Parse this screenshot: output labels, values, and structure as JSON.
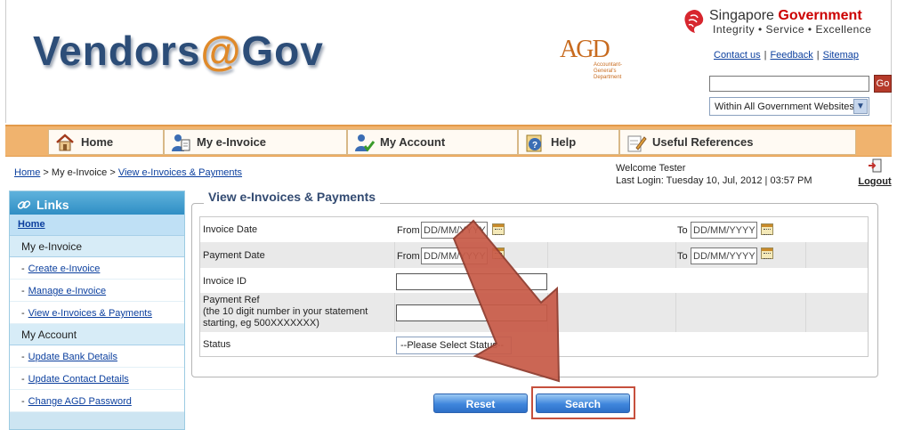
{
  "header": {
    "logo_part1": "Vendors",
    "logo_at": "@",
    "logo_part2": "Gov",
    "agd_letters": "AGD",
    "agd_sub1": "Accountant-",
    "agd_sub2": "General's",
    "agd_sub3": "Department",
    "sg_title_1": "Singapore",
    "sg_title_2": "Government",
    "sg_motto": "Integrity • Service • Excellence",
    "links": {
      "contact": "Contact us",
      "feedback": "Feedback",
      "sitemap": "Sitemap",
      "sep": "|"
    },
    "search_value": "",
    "go_label": "Go",
    "scope_selected": "Within All Government Websites"
  },
  "nav": {
    "home": "Home",
    "einvoice": "My e-Invoice",
    "account": "My Account",
    "help": "Help",
    "references": "Useful References"
  },
  "breadcrumb": {
    "home": "Home",
    "sep": ">",
    "einvoice": "My e-Invoice",
    "current": "View e-Invoices & Payments"
  },
  "user": {
    "welcome": "Welcome Tester",
    "last_login": "Last Login: Tuesday 10, Jul, 2012 | 03:57 PM",
    "logout": "Logout"
  },
  "sidebar": {
    "title": "Links",
    "home": "Home",
    "section1": "My e-Invoice",
    "items1": [
      "Create e-Invoice",
      "Manage e-Invoice",
      "View e-Invoices & Payments"
    ],
    "section2": "My Account",
    "items2": [
      "Update Bank Details",
      "Update Contact Details",
      "Change AGD Password"
    ],
    "dash": "-"
  },
  "form": {
    "legend": "View e-Invoices & Payments",
    "invoice_date_label": "Invoice Date",
    "payment_date_label": "Payment Date",
    "from_label": "From",
    "to_label": "To",
    "date_placeholder": "DD/MM/YYYY",
    "invoice_id_label": "Invoice ID",
    "payment_ref_label_1": "Payment Ref",
    "payment_ref_label_2": "(the 10 digit number in your statement",
    "payment_ref_label_3": "starting, eg 500XXXXXXX)",
    "status_label": "Status",
    "status_selected": "--Please Select Status--"
  },
  "buttons": {
    "reset": "Reset",
    "search": "Search"
  },
  "colors": {
    "nav_bar": "#f0b36e",
    "sidebar_bg": "#cde5f2",
    "button_blue": "#3f86dc",
    "highlight_red": "#c6503d",
    "legend_text": "#334b72"
  }
}
